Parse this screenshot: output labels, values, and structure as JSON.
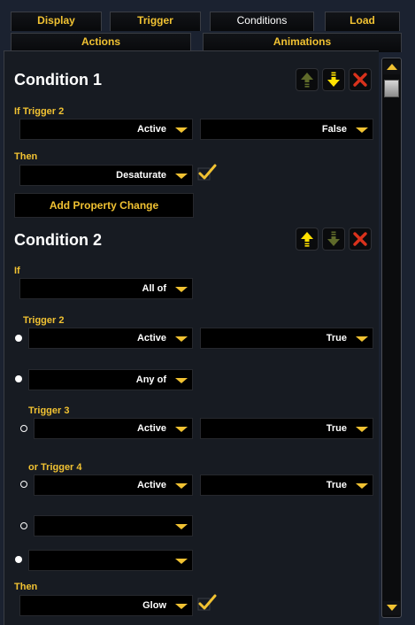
{
  "tabs": {
    "display": "Display",
    "trigger": "Trigger",
    "conditions": "Conditions",
    "load": "Load",
    "actions": "Actions",
    "animations": "Animations"
  },
  "condition1": {
    "title": "Condition 1",
    "if_label": "If Trigger 2",
    "state_value": "Active",
    "compare_value": "False",
    "then_label": "Then",
    "property_value": "Desaturate",
    "add_property_label": "Add Property Change"
  },
  "condition2": {
    "title": "Condition 2",
    "if_label": "If",
    "mode_value": "All of",
    "trigger2_label": "Trigger 2",
    "trigger2_state": "Active",
    "trigger2_compare": "True",
    "group_value": "Any of",
    "trigger3_label": "Trigger 3",
    "trigger3_state": "Active",
    "trigger3_compare": "True",
    "trigger4_label": "or Trigger 4",
    "trigger4_state": "Active",
    "trigger4_compare": "True",
    "empty_value_1": "",
    "empty_value_2": "",
    "then_label": "Then",
    "property_value": "Glow"
  },
  "colors": {
    "accent": "#f1c232",
    "background": "#171b22",
    "field": "#000000",
    "delete": "#d9321c"
  },
  "icons": [
    "move-up-icon",
    "move-down-icon",
    "delete-icon",
    "checkmark-icon",
    "scroll-up-icon",
    "scroll-down-icon"
  ]
}
